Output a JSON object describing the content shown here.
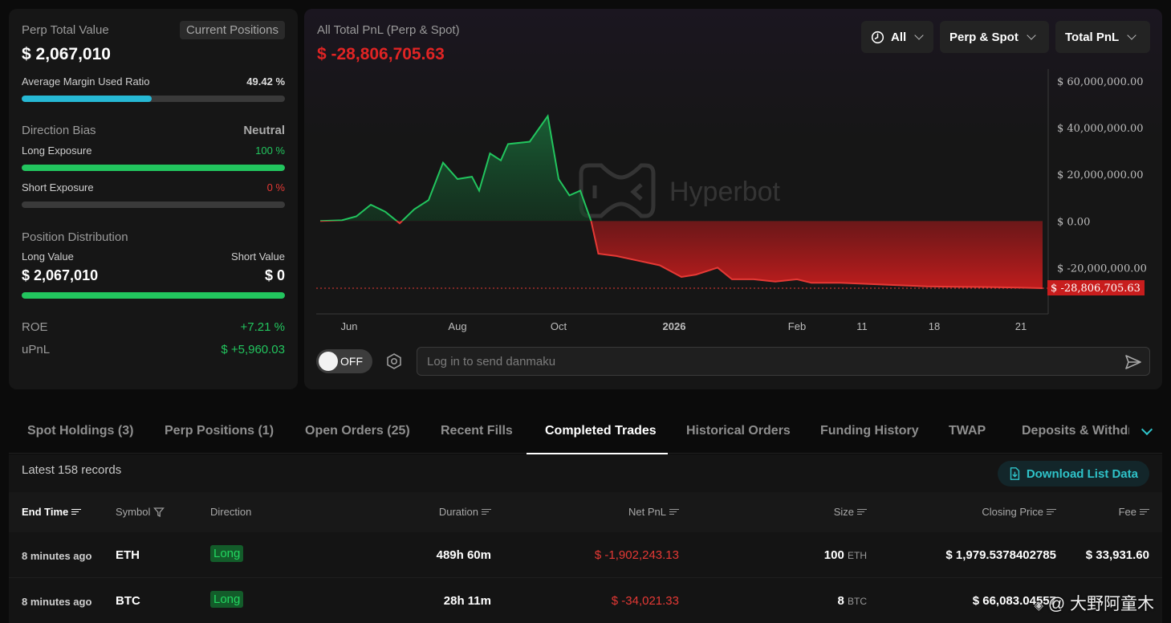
{
  "summary": {
    "perp_total_value_label": "Perp Total Value",
    "current_positions_label": "Current Positions",
    "perp_total_value": "$ 2,067,010",
    "avg_margin_label": "Average Margin Used Ratio",
    "avg_margin_value": "49.42 %",
    "avg_margin_fraction": 0.4942,
    "direction_bias_label": "Direction Bias",
    "direction_bias_value": "Neutral",
    "long_exposure_label": "Long Exposure",
    "long_exposure_value": "100 %",
    "long_exposure_fraction": 1.0,
    "short_exposure_label": "Short Exposure",
    "short_exposure_value": "0 %",
    "short_exposure_fraction": 0.0,
    "position_distribution_label": "Position Distribution",
    "long_value_label": "Long Value",
    "short_value_label": "Short Value",
    "long_value": "$ 2,067,010",
    "short_value": "$ 0",
    "long_share_fraction": 1.0,
    "roe_label": "ROE",
    "roe_value": "+7.21 %",
    "upnl_label": "uPnL",
    "upnl_value": "$ +5,960.03"
  },
  "chart_header": {
    "title": "All Total PnL (Perp & Spot)",
    "value": "$ -28,806,705.63",
    "watermark": "Hyperbot",
    "range_filter": "All",
    "market_filter": "Perp & Spot",
    "metric_filter": "Total PnL"
  },
  "chart_data": {
    "type": "area",
    "title": "All Total PnL (Perp & Spot)",
    "xlabel": "",
    "ylabel": "",
    "ylim": [
      -28806705.63,
      60000000
    ],
    "y_ticks": [
      "$ 60,000,000.00",
      "$ 40,000,000.00",
      "$ 20,000,000.00",
      "$ 0.00",
      "$ -20,000,000.00"
    ],
    "y_tick_values": [
      60000000,
      40000000,
      20000000,
      0,
      -20000000
    ],
    "x_ticks": [
      "Jun",
      "Aug",
      "Oct",
      "2026",
      "Feb",
      "11",
      "18",
      "21"
    ],
    "x_tick_positions": [
      0.04,
      0.19,
      0.33,
      0.49,
      0.66,
      0.75,
      0.85,
      0.97
    ],
    "current_value": -28806705.63,
    "current_value_label": "$ -28,806,705.63",
    "colors": {
      "positive": "#22c55e",
      "negative": "#e53935"
    },
    "points": [
      [
        0.0,
        0
      ],
      [
        0.03,
        300000
      ],
      [
        0.05,
        2000000
      ],
      [
        0.07,
        7000000
      ],
      [
        0.09,
        4000000
      ],
      [
        0.11,
        -1000000
      ],
      [
        0.13,
        5000000
      ],
      [
        0.15,
        9000000
      ],
      [
        0.17,
        25000000
      ],
      [
        0.19,
        18000000
      ],
      [
        0.21,
        19000000
      ],
      [
        0.22,
        13000000
      ],
      [
        0.235,
        29000000
      ],
      [
        0.25,
        26000000
      ],
      [
        0.26,
        33000000
      ],
      [
        0.29,
        34000000
      ],
      [
        0.315,
        45000000
      ],
      [
        0.33,
        18000000
      ],
      [
        0.345,
        11000000
      ],
      [
        0.36,
        13000000
      ],
      [
        0.375,
        0
      ],
      [
        0.385,
        -14000000
      ],
      [
        0.41,
        -15000000
      ],
      [
        0.44,
        -17000000
      ],
      [
        0.47,
        -19000000
      ],
      [
        0.5,
        -24000000
      ],
      [
        0.52,
        -23000000
      ],
      [
        0.55,
        -20000000
      ],
      [
        0.57,
        -25000000
      ],
      [
        0.6,
        -25000000
      ],
      [
        0.63,
        -26000000
      ],
      [
        0.66,
        -25000000
      ],
      [
        0.68,
        -26500000
      ],
      [
        0.72,
        -26500000
      ],
      [
        0.76,
        -27000000
      ],
      [
        0.8,
        -27500000
      ],
      [
        0.84,
        -28000000
      ],
      [
        0.88,
        -28200000
      ],
      [
        0.92,
        -28300000
      ],
      [
        0.96,
        -28500000
      ],
      [
        1.0,
        -28806705.63
      ]
    ]
  },
  "danmaku": {
    "toggle_label": "OFF",
    "placeholder": "Log in to send danmaku"
  },
  "tabs": [
    "Spot Holdings (3)",
    "Perp Positions (1)",
    "Open Orders (25)",
    "Recent Fills",
    "Completed Trades",
    "Historical Orders",
    "Funding History",
    "TWAP",
    "Deposits & Withdra"
  ],
  "list": {
    "records_label": "Latest 158 records",
    "download_label": "Download List Data",
    "columns": [
      "End Time",
      "Symbol",
      "Direction",
      "Duration",
      "Net PnL",
      "Size",
      "Closing Price",
      "Fee"
    ],
    "rows": [
      {
        "end_time": "8 minutes ago",
        "symbol": "ETH",
        "direction": "Long",
        "duration": "489h 60m",
        "net_pnl": "$ -1,902,243.13",
        "size": "100",
        "size_unit": "ETH",
        "closing_price": "$ 1,979.5378402785",
        "fee": "$ 33,931.60"
      },
      {
        "end_time": "8 minutes ago",
        "symbol": "BTC",
        "direction": "Long",
        "duration": "28h 11m",
        "net_pnl": "$ -34,021.33",
        "size": "8",
        "size_unit": "BTC",
        "closing_price": "$ 66,083.04557",
        "fee": ""
      }
    ]
  },
  "watermark_credit": "@ 大野阿童木"
}
